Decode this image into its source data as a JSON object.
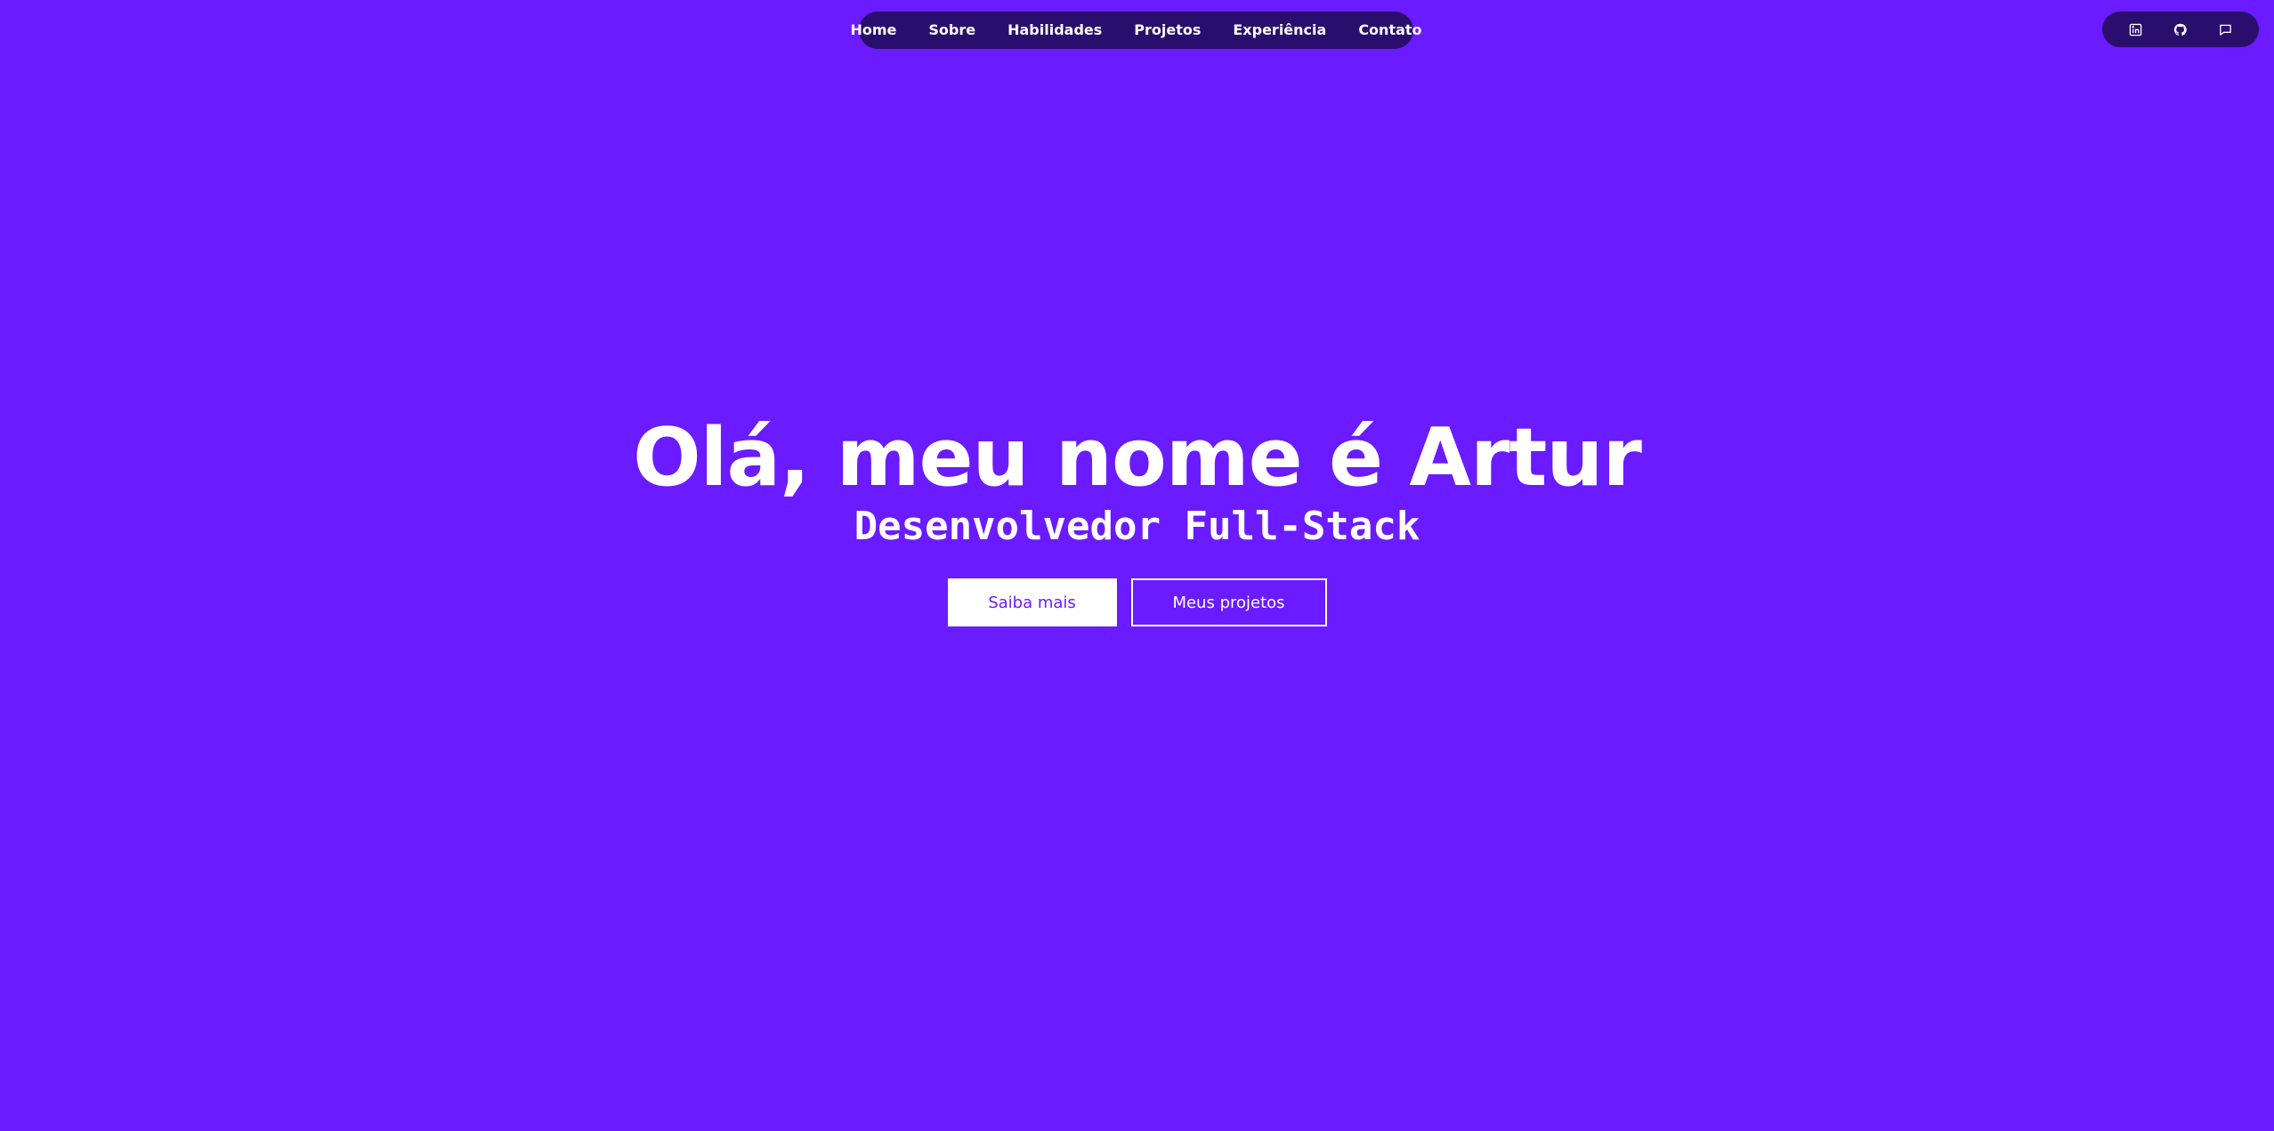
{
  "nav": {
    "items": [
      {
        "label": "Home"
      },
      {
        "label": "Sobre"
      },
      {
        "label": "Habilidades"
      },
      {
        "label": "Projetos"
      },
      {
        "label": "Experiência"
      },
      {
        "label": "Contato"
      }
    ]
  },
  "social": {
    "icons": [
      "linkedin-icon",
      "github-icon",
      "message-icon"
    ]
  },
  "hero": {
    "title": "Olá, meu nome é Artur",
    "subtitle": "Desenvolvedor Full-Stack",
    "primary_button": "Saiba mais",
    "secondary_button": "Meus projetos"
  },
  "colors": {
    "background": "#6a1bff",
    "pill": "#2a0e6e",
    "text": "#ffffff"
  }
}
